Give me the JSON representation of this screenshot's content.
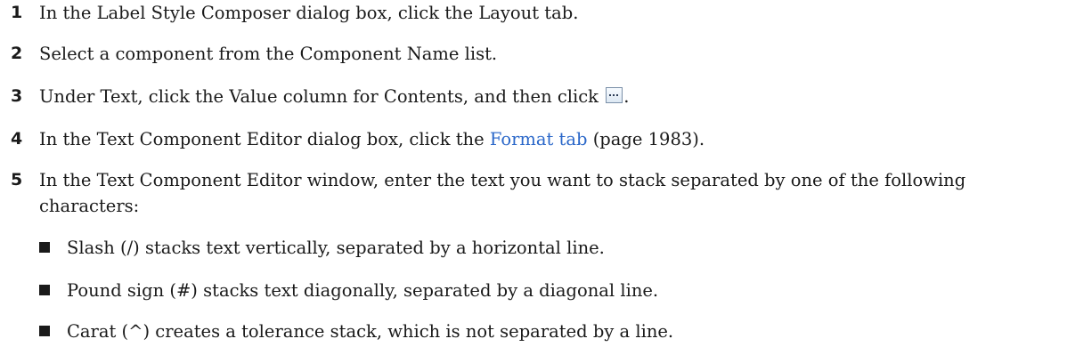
{
  "steps": [
    {
      "number": "1",
      "text": "In the Label Style Composer dialog box, click the Layout tab."
    },
    {
      "number": "2",
      "text": "Select a component from the Component Name list."
    },
    {
      "number": "3",
      "text_before": "Under Text, click the Value column for Contents, and then click",
      "text_after": ".",
      "icon": "ellipsis-button-icon"
    },
    {
      "number": "4",
      "text_before": "In the Text Component Editor dialog box, click the",
      "link_text": "Format tab",
      "text_after": "(page 1983).",
      "link_color": "#2a67c9"
    },
    {
      "number": "5",
      "text": "In the Text Component Editor window, enter the text you want to stack separated by one of the following characters:"
    }
  ],
  "bullets": [
    "Slash (/) stacks text vertically, separated by a horizontal line.",
    "Pound sign (#) stacks text diagonally, separated by a diagonal line.",
    "Carat (^) creates a tolerance stack, which is not separated by a line."
  ]
}
